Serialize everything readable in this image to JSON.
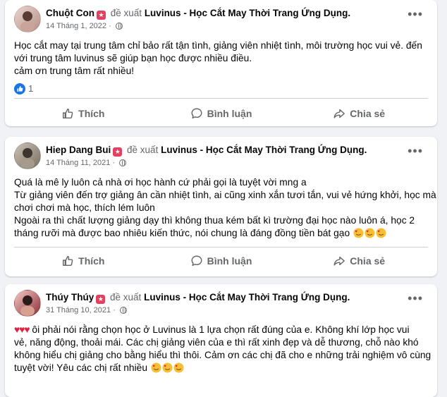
{
  "posts": [
    {
      "author": "Chuột Con",
      "recommend_text": "đề xuất",
      "page_name": "Luvinus - Học Cắt May Thời Trang Ứng Dụng.",
      "date": "14 Tháng 1, 2022",
      "lines": [
        "Học cắt may tại trung tâm chỉ bảo rất tận tình, giảng viên nhiệt tình, môi trường học vui vẻ. đến",
        "với trung tâm luvinus sẽ giúp bạn học được nhiều điều.",
        "cảm ơn trung tâm rất nhiều!"
      ],
      "reaction_count": "1"
    },
    {
      "author": "Hiep Dang Bui",
      "recommend_text": "đề xuất",
      "page_name": "Luvinus - Học Cắt May Thời Trang Ứng Dụng.",
      "date": "14 Tháng 11, 2021",
      "lines": [
        "Quá là mê ly luôn cả nhà ơi học hành cứ phải gọi là tuyệt vời mng a",
        "Từ giảng viên đến trợ giảng ân cần nhiệt tình, ai cũng xinh xắn tươi tắn, vui vẻ hứng khởi, học mà",
        "chơi chơi mà học, thích lém luôn",
        "Ngoài ra thì chất lượng giảng dạy thì không thua kém bất kì trường đại học nào luôn á, học 2",
        "tháng rưỡi mà được bao nhiêu kiến thức, nói chung là đáng đồng tiền bát gạo"
      ]
    },
    {
      "author": "Thúy Thúy",
      "recommend_text": "đề xuất",
      "page_name": "Luvinus - Học Cắt May Thời Trang Ứng Dụng.",
      "date": "31 Tháng 10, 2021",
      "lines": [
        "ôi phải nói rằng chọn học ở Luvinus là 1 lựa chọn rất đúng của e. Không khí lớp học vui",
        "vẻ, năng động, thoải mái. Các chị giảng viên của e thì rất xinh đẹp và dễ thương, chỗ nào khó",
        "không hiểu chị giảng cho bằng hiểu thì thôi. Cảm ơn các chị đã cho e những trải nghiệm vô cùng",
        "tuyệt vời! Yêu các chị rất nhiều"
      ]
    }
  ],
  "actions": {
    "like": "Thích",
    "comment": "Bình luận",
    "share": "Chia sẻ"
  },
  "icons": {
    "recommend": "recommend-star-icon",
    "globe": "globe-icon",
    "more": "more-options-icon",
    "like": "thumbs-up-icon",
    "comment": "comment-bubble-icon",
    "share": "share-arrow-icon",
    "emoji": "smiling-face-with-hearts-emoji",
    "heart": "red-heart-emoji"
  },
  "colors": {
    "accent": "#1b74e4",
    "recommend": "#e4405f",
    "heart": "#e41e3f"
  }
}
